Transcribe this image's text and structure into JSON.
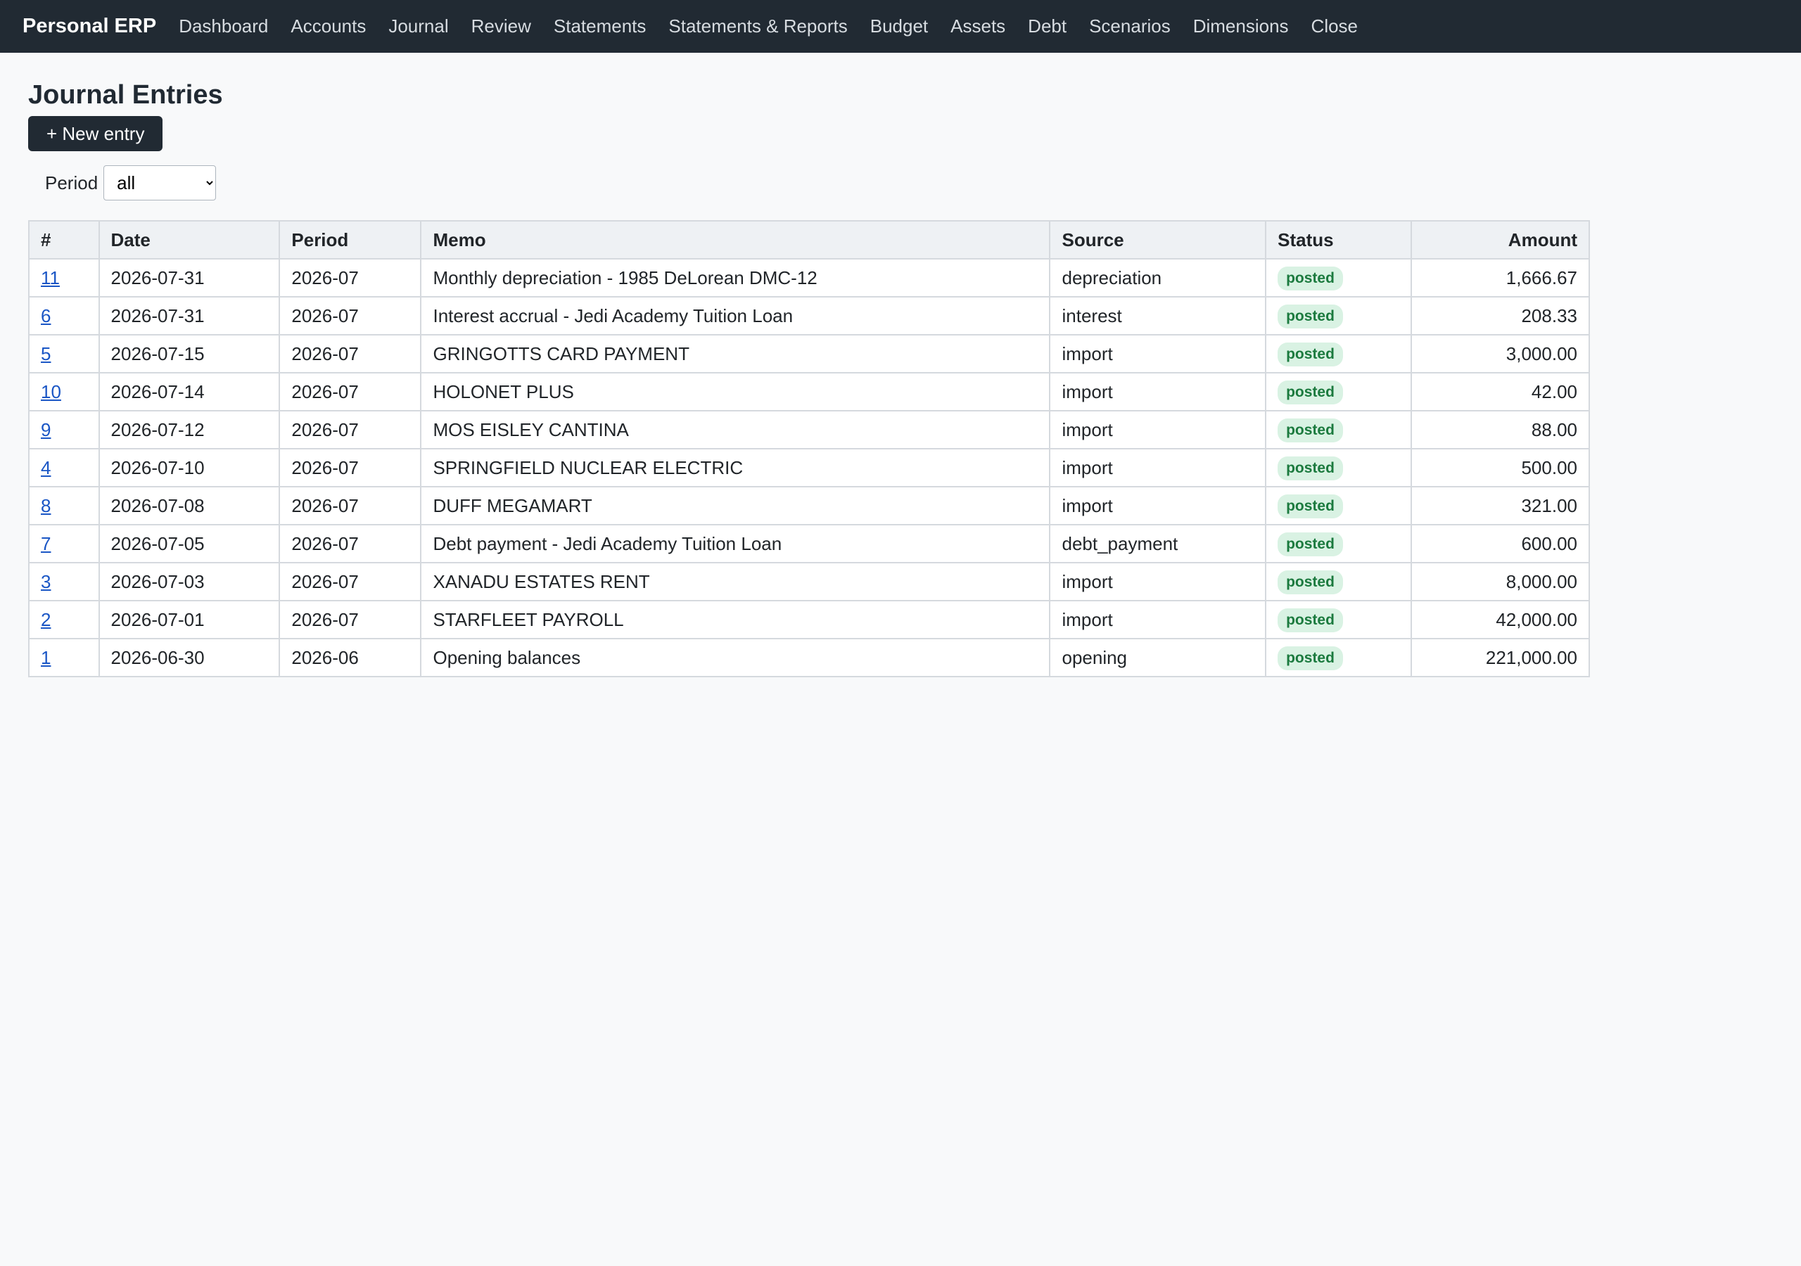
{
  "nav": {
    "brand": "Personal ERP",
    "links": [
      "Dashboard",
      "Accounts",
      "Journal",
      "Review",
      "Statements",
      "Statements & Reports",
      "Budget",
      "Assets",
      "Debt",
      "Scenarios",
      "Dimensions",
      "Close"
    ]
  },
  "page": {
    "title": "Journal Entries",
    "new_entry_label": "+ New entry"
  },
  "filter": {
    "period_label": "Period",
    "period_value": "all"
  },
  "table": {
    "headers": [
      "#",
      "Date",
      "Period",
      "Memo",
      "Source",
      "Status",
      "Amount"
    ],
    "rows": [
      {
        "id": "11",
        "date": "2026-07-31",
        "period": "2026-07",
        "memo": "Monthly depreciation - 1985 DeLorean DMC-12",
        "source": "depreciation",
        "status": "posted",
        "amount": "1,666.67"
      },
      {
        "id": "6",
        "date": "2026-07-31",
        "period": "2026-07",
        "memo": "Interest accrual - Jedi Academy Tuition Loan",
        "source": "interest",
        "status": "posted",
        "amount": "208.33"
      },
      {
        "id": "5",
        "date": "2026-07-15",
        "period": "2026-07",
        "memo": "GRINGOTTS CARD PAYMENT",
        "source": "import",
        "status": "posted",
        "amount": "3,000.00"
      },
      {
        "id": "10",
        "date": "2026-07-14",
        "period": "2026-07",
        "memo": "HOLONET PLUS",
        "source": "import",
        "status": "posted",
        "amount": "42.00"
      },
      {
        "id": "9",
        "date": "2026-07-12",
        "period": "2026-07",
        "memo": "MOS EISLEY CANTINA",
        "source": "import",
        "status": "posted",
        "amount": "88.00"
      },
      {
        "id": "4",
        "date": "2026-07-10",
        "period": "2026-07",
        "memo": "SPRINGFIELD NUCLEAR ELECTRIC",
        "source": "import",
        "status": "posted",
        "amount": "500.00"
      },
      {
        "id": "8",
        "date": "2026-07-08",
        "period": "2026-07",
        "memo": "DUFF MEGAMART",
        "source": "import",
        "status": "posted",
        "amount": "321.00"
      },
      {
        "id": "7",
        "date": "2026-07-05",
        "period": "2026-07",
        "memo": "Debt payment - Jedi Academy Tuition Loan",
        "source": "debt_payment",
        "status": "posted",
        "amount": "600.00"
      },
      {
        "id": "3",
        "date": "2026-07-03",
        "period": "2026-07",
        "memo": "XANADU ESTATES RENT",
        "source": "import",
        "status": "posted",
        "amount": "8,000.00"
      },
      {
        "id": "2",
        "date": "2026-07-01",
        "period": "2026-07",
        "memo": "STARFLEET PAYROLL",
        "source": "import",
        "status": "posted",
        "amount": "42,000.00"
      },
      {
        "id": "1",
        "date": "2026-06-30",
        "period": "2026-06",
        "memo": "Opening balances",
        "source": "opening",
        "status": "posted",
        "amount": "221,000.00"
      }
    ]
  },
  "colors": {
    "nav_bg": "#212a33",
    "badge_bg": "#d9f2e3",
    "badge_text": "#1b7a3e",
    "link": "#1a56c5"
  }
}
